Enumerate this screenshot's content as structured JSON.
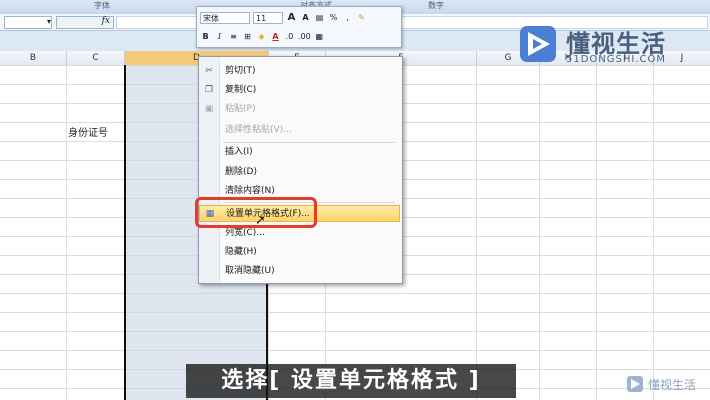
{
  "ribbon": {
    "groups": [
      "字体",
      "对齐方式",
      "数字"
    ]
  },
  "formula_bar": {
    "name_box_value": "▾",
    "fx_label": "fx",
    "formula_value": ""
  },
  "columns": [
    "B",
    "C",
    "D",
    "E",
    "F",
    "G",
    "H",
    "I",
    "J"
  ],
  "cells": {
    "c_label": "身份证号"
  },
  "mini_toolbar": {
    "font_name": "宋体",
    "font_size": "11",
    "grow_font": "A",
    "shrink_font": "A",
    "percent": "%",
    "comma": ",",
    "bold": "B",
    "italic": "I",
    "center": "≡",
    "font_color": "A",
    "dec_inc": ".0",
    "dec_dec": ".00"
  },
  "context_menu": {
    "items": [
      {
        "label": "剪切(T)",
        "icon": "scissors-icon",
        "disabled": false
      },
      {
        "label": "复制(C)",
        "icon": "copy-icon",
        "disabled": false
      },
      {
        "label": "粘贴(P)",
        "icon": "paste-icon",
        "disabled": true
      },
      {
        "label": "选择性粘贴(V)...",
        "icon": "",
        "disabled": true
      },
      {
        "label": "插入(I)",
        "icon": "",
        "disabled": false
      },
      {
        "label": "删除(D)",
        "icon": "",
        "disabled": false
      },
      {
        "label": "清除内容(N)",
        "icon": "",
        "disabled": false
      },
      {
        "label": "设置单元格格式(F)...",
        "icon": "format-cells-icon",
        "disabled": false,
        "highlighted": true
      },
      {
        "label": "列宽(C)...",
        "icon": "",
        "disabled": false
      },
      {
        "label": "隐藏(H)",
        "icon": "",
        "disabled": false
      },
      {
        "label": "取消隐藏(U)",
        "icon": "",
        "disabled": false
      }
    ]
  },
  "watermark": {
    "title": "懂视生活",
    "url": "51DONGSHI.COM",
    "corner_text": "懂视生活"
  },
  "subtitle": "选择[ 设置单元格格式 ]",
  "colors": {
    "highlight": "#ffd46a",
    "annotation": "#e53b2e",
    "selected_column": "#dfe6ef"
  }
}
